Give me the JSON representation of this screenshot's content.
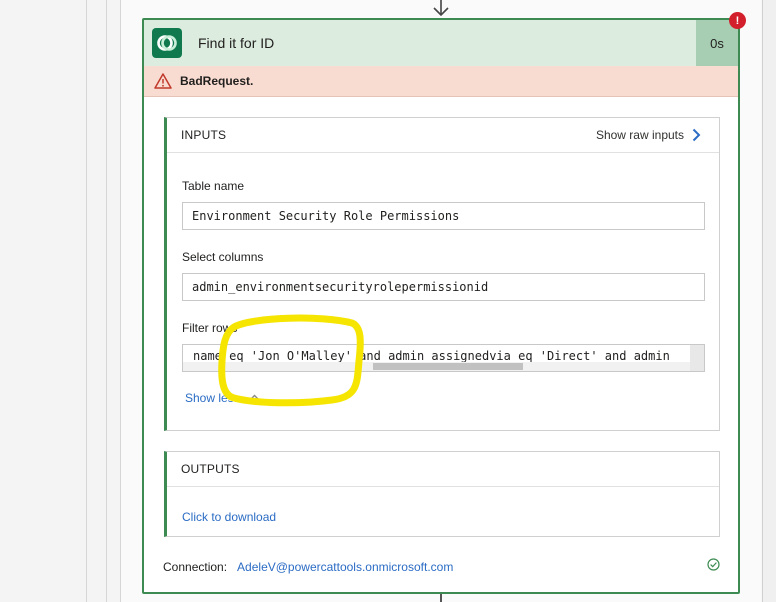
{
  "action": {
    "title": "Find it for ID",
    "duration": "0s",
    "error_badge": "!",
    "error_message": "BadRequest."
  },
  "inputs": {
    "heading": "INPUTS",
    "show_raw_label": "Show raw inputs",
    "table_name_label": "Table name",
    "table_name_value": "Environment Security Role Permissions",
    "select_columns_label": "Select columns",
    "select_columns_value": "admin_environmentsecurityrolepermissionid",
    "filter_rows_label": "Filter rows",
    "filter_rows_value": "name eq 'Jon O'Malley' and admin_assignedvia eq 'Direct' and admin",
    "show_less_label": "Show less"
  },
  "outputs": {
    "heading": "OUTPUTS",
    "download_label": "Click to download"
  },
  "connection": {
    "label": "Connection:",
    "account": "AdeleV@powercattools.onmicrosoft.com"
  },
  "colors": {
    "accent_green": "#3d8b52",
    "error_red": "#d31f2b",
    "link_blue": "#2b6cc4",
    "highlight_yellow": "#f5e500"
  },
  "icons": [
    "dataverse-logo-icon",
    "warning-icon",
    "chevron-right-icon",
    "chevron-up-icon",
    "check-circle-icon",
    "arrow-down-icon"
  ]
}
